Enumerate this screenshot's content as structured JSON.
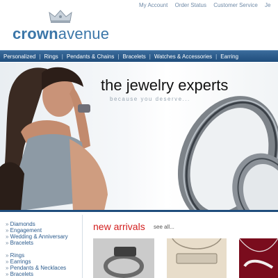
{
  "brand": {
    "part1": "crown",
    "part2": "avenue"
  },
  "top_links": [
    "My Account",
    "Order Status",
    "Customer Service",
    "Je"
  ],
  "nav": [
    "Personalized",
    "Rings",
    "Pendants & Chains",
    "Bracelets",
    "Watches & Accessories",
    "Earring"
  ],
  "hero": {
    "headline": "the jewelry experts",
    "tagline": "because you deserve..."
  },
  "sidebar": {
    "group1": [
      "Diamonds",
      "Engagement",
      "Wedding & Anniversary",
      "Bracelets"
    ],
    "group2": [
      "Rings",
      "Earrings",
      "Pendants & Necklaces",
      "Bracelets"
    ]
  },
  "new_arrivals": {
    "title": "new arrivals",
    "see_all": "see all..."
  },
  "colors": {
    "brand_blue": "#3b76a8",
    "nav_blue": "#1f4d7c",
    "accent_red": "#d21d1d"
  }
}
